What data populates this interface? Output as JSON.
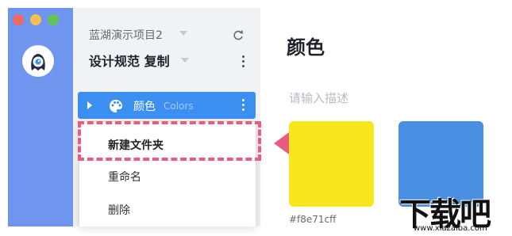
{
  "sidebar": {
    "project_name": "蓝湖演示项目2",
    "doc_title": "设计规范 复制",
    "colors_item": {
      "label": "颜色",
      "label_en": "Colors"
    }
  },
  "context_menu": {
    "items": [
      {
        "label": "新建文件夹"
      },
      {
        "label": "重命名"
      },
      {
        "label": "删除"
      }
    ]
  },
  "main": {
    "title": "颜色",
    "description_placeholder": "请输入描述",
    "swatches": [
      {
        "color": "#f8e71c",
        "label": "#f8e71cff"
      },
      {
        "color": "#4a90e2",
        "label": ""
      }
    ]
  },
  "watermark": {
    "text": "下载吧",
    "url": "www.xiazaiba.com"
  },
  "colors": {
    "rail": "#6f95ef",
    "accent": "#3b8ff0",
    "annotation": "#e85d7f"
  },
  "icons": [
    "app-monster-logo-icon",
    "refresh-icon",
    "more-vertical-icon",
    "palette-icon",
    "caret-right-icon"
  ]
}
